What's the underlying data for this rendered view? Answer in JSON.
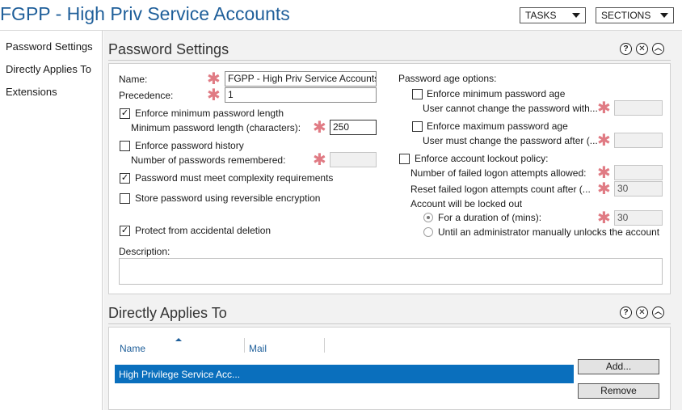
{
  "window": {
    "title": "FGPP - High Priv Service Accounts",
    "tasks_label": "TASKS",
    "sections_label": "SECTIONS"
  },
  "nav": {
    "items": [
      {
        "label": "Password Settings"
      },
      {
        "label": "Directly Applies To"
      },
      {
        "label": "Extensions"
      }
    ]
  },
  "password_settings": {
    "title": "Password Settings",
    "help_icon": "?",
    "close_icon": "✕",
    "collapse_icon": "︿",
    "name_label": "Name:",
    "name_value": "FGPP - High Priv Service Accounts",
    "precedence_label": "Precedence:",
    "precedence_value": "1",
    "enforce_min_length_label": "Enforce minimum password length",
    "enforce_min_length_checked": true,
    "min_length_label": "Minimum password length (characters):",
    "min_length_value": "250",
    "enforce_history_label": "Enforce password history",
    "enforce_history_checked": false,
    "history_count_label": "Number of passwords remembered:",
    "history_count_value": "",
    "complexity_label": "Password must meet complexity requirements",
    "complexity_checked": true,
    "reversible_label": "Store password using reversible encryption",
    "reversible_checked": false,
    "protect_label": "Protect from accidental deletion",
    "protect_checked": true,
    "description_label": "Description:",
    "description_value": "",
    "age_options_label": "Password age options:",
    "enforce_min_age_label": "Enforce minimum password age",
    "enforce_min_age_checked": false,
    "min_age_sub_label": "User cannot change the password with...",
    "min_age_value": "",
    "enforce_max_age_label": "Enforce maximum password age",
    "enforce_max_age_checked": false,
    "max_age_sub_label": "User must change the password after (...",
    "max_age_value": "",
    "lockout_label": "Enforce account lockout policy:",
    "lockout_checked": false,
    "failed_attempts_label": "Number of failed logon attempts allowed:",
    "failed_attempts_value": "",
    "reset_count_label": "Reset failed logon attempts count after (...",
    "reset_count_value": "30",
    "locked_out_label": "Account will be locked out",
    "duration_label": "For a duration of (mins):",
    "duration_value": "30",
    "until_admin_label": "Until an administrator manually unlocks the account"
  },
  "directly_applies": {
    "title": "Directly Applies To",
    "help_icon": "?",
    "close_icon": "✕",
    "collapse_icon": "︿",
    "col_name": "Name",
    "col_mail": "Mail",
    "rows": [
      {
        "name": "High Privilege Service Acc...",
        "mail": ""
      }
    ],
    "add_label": "Add...",
    "remove_label": "Remove"
  },
  "required_marker": "✱",
  "check_mark": "✓",
  "colors": {
    "title_blue": "#1f5f9a",
    "selection_blue": "#0a6fbd",
    "required_pink": "#e07b84"
  }
}
